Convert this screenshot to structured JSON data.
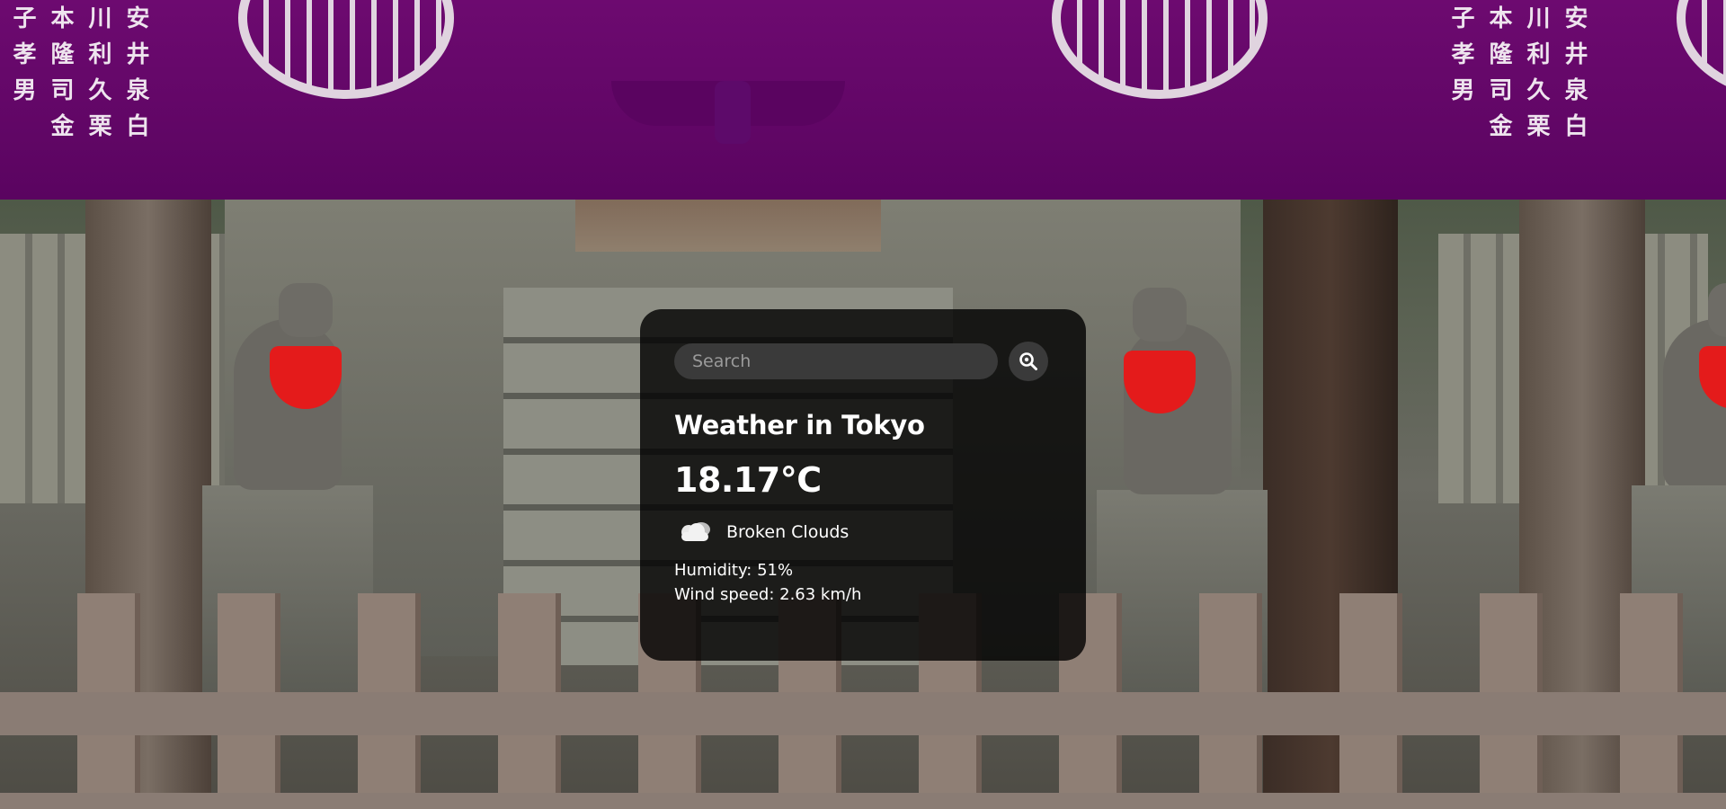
{
  "search": {
    "placeholder": "Search"
  },
  "weather": {
    "heading": "Weather in Tokyo",
    "temperature": "18.17°C",
    "condition": "Broken Clouds",
    "condition_icon": "broken-clouds-icon",
    "humidity": "Humidity: 51%",
    "wind": "Wind speed: 2.63 km/h"
  },
  "background": {
    "banner_text": "安井泉白川利久栗本隆司金子孝男"
  },
  "colors": {
    "card_bg": "rgba(0,0,0,0.80)",
    "input_bg": "#3a3a3a",
    "text": "#ffffff",
    "banner": "#6d0a70",
    "bib": "#e41b1b"
  }
}
